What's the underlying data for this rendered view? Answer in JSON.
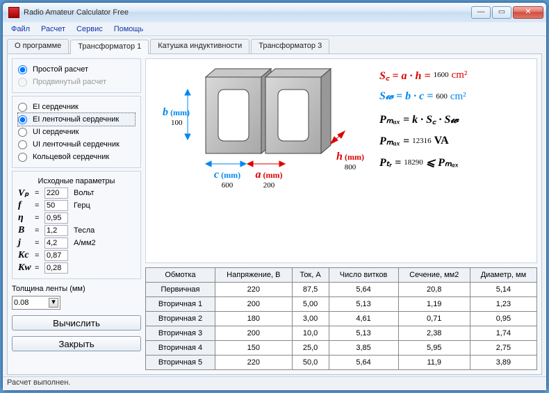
{
  "window": {
    "title": "Radio Amateur Calculator Free"
  },
  "menu": {
    "file": "Файл",
    "calc": "Расчет",
    "service": "Сервис",
    "help": "Помощь"
  },
  "tabs": {
    "about": "О программе",
    "t1": "Трансформатор 1",
    "coil": "Катушка индуктивности",
    "t3": "Трансформатор 3"
  },
  "calcmode": {
    "simple": "Простой расчет",
    "advanced": "Продвинутый расчет"
  },
  "core": {
    "ei": "EI сердечник",
    "ei_tape": "EI ленточный сердечник",
    "ui": "UI сердечник",
    "ui_tape": "UI ленточный сердечник",
    "ring": "Кольцевой сердечник"
  },
  "params_title": "Исходные параметры",
  "params": {
    "Vp": {
      "sym": "Vₚ",
      "val": "220",
      "unit": "Вольт"
    },
    "f": {
      "sym": "f",
      "val": "50",
      "unit": "Герц"
    },
    "eta": {
      "sym": "η",
      "val": "0,95",
      "unit": ""
    },
    "B": {
      "sym": "B",
      "val": "1,2",
      "unit": "Тесла"
    },
    "j": {
      "sym": "j",
      "val": "4,2",
      "unit": "А/мм2"
    },
    "Kc": {
      "sym": "Kc",
      "val": "0,87",
      "unit": ""
    },
    "Kw": {
      "sym": "Kw",
      "val": "0,28",
      "unit": ""
    }
  },
  "thickness": {
    "label": "Толщина ленты (мм)",
    "value": "0.08"
  },
  "buttons": {
    "calc": "Вычислить",
    "close": "Закрыть"
  },
  "dims": {
    "b": {
      "label": "b",
      "unit": "(mm)",
      "val": "100"
    },
    "c": {
      "label": "c",
      "unit": "(mm)",
      "val": "600"
    },
    "a": {
      "label": "a",
      "unit": "(mm)",
      "val": "200"
    },
    "h": {
      "label": "h",
      "unit": "(mm)",
      "val": "800"
    }
  },
  "formulas": {
    "Sc": {
      "lhs": "S꜀ = a · h =",
      "val": "1600",
      "unit": "cm²"
    },
    "Sw": {
      "lhs": "S𝓌 = b · c =",
      "val": "600",
      "unit": "cm²"
    },
    "Pmax1": "Pₘₐₓ = k · S꜀ · S𝓌",
    "Pmax2_lhs": "Pₘₐₓ =",
    "Pmax2_val": "12316",
    "Pmax2_unit": "VA",
    "Ptr_lhs": "Pₜᵣ   =",
    "Ptr_val": "18290",
    "Ptr_rhs": "⩽ Pₘₐₓ"
  },
  "table": {
    "headers": [
      "Обмотка",
      "Напряжение, В",
      "Ток, А",
      "Число витков",
      "Сечение, мм2",
      "Диаметр, мм"
    ],
    "rows": [
      [
        "Первичная",
        "220",
        "87,5",
        "5,64",
        "20,8",
        "5,14"
      ],
      [
        "Вторичная 1",
        "200",
        "5,00",
        "5,13",
        "1,19",
        "1,23"
      ],
      [
        "Вторичная 2",
        "180",
        "3,00",
        "4,61",
        "0,71",
        "0,95"
      ],
      [
        "Вторичная 3",
        "200",
        "10,0",
        "5,13",
        "2,38",
        "1,74"
      ],
      [
        "Вторичная 4",
        "150",
        "25,0",
        "3,85",
        "5,95",
        "2,75"
      ],
      [
        "Вторичная 5",
        "220",
        "50,0",
        "5,64",
        "11,9",
        "3,89"
      ]
    ]
  },
  "status": "Расчет выполнен."
}
